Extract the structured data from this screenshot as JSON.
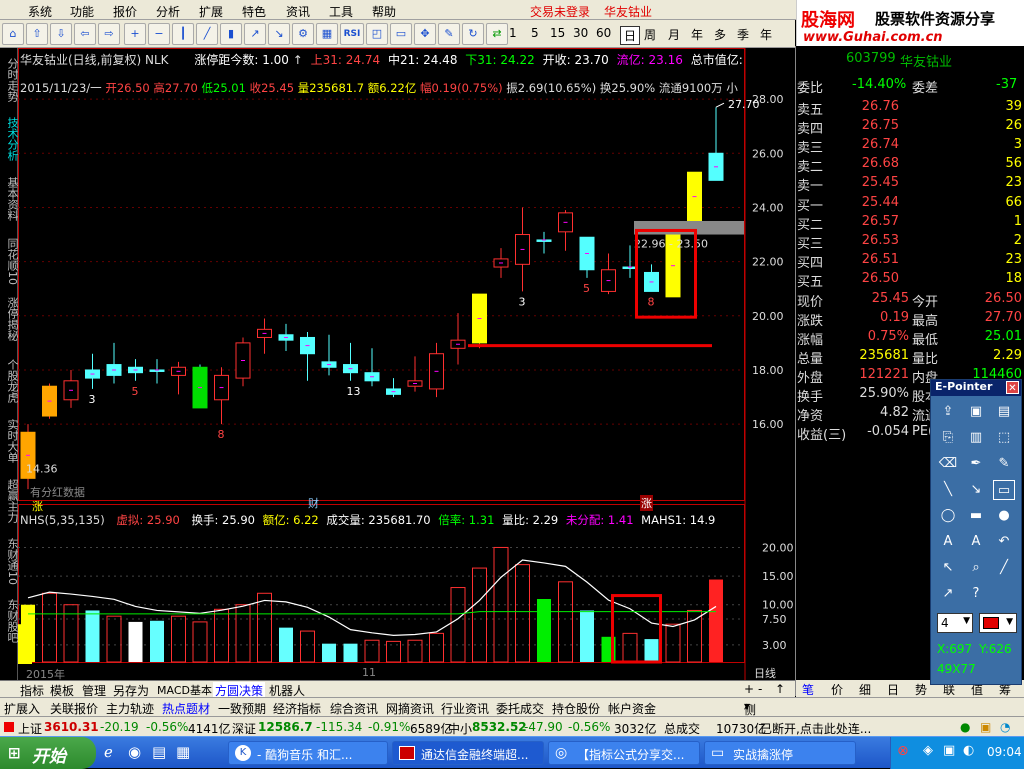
{
  "menu": {
    "items": [
      "系统",
      "功能",
      "报价",
      "分析",
      "扩展",
      "特色",
      "资讯",
      "工具",
      "帮助"
    ],
    "login_status": "交易未登录",
    "stock_title": "华友钴业"
  },
  "logo": {
    "line1_a": "股海网",
    "line1_b": "股票软件资源分享",
    "line2": "www.Guhai.com.cn"
  },
  "toolbar": {
    "periods": [
      "1",
      "5",
      "15",
      "30",
      "60",
      "日",
      "周",
      "月",
      "年",
      "多",
      "季",
      "年"
    ]
  },
  "vertical_tabs": [
    "分时走势",
    "技术分析",
    "基本资料",
    "同花顺10",
    "涨停揭秘",
    "个股龙虎",
    "实时大单",
    "超赢主力",
    "东财通10",
    "东财股吧"
  ],
  "chart_header": {
    "title": "华友钴业(日线,前复权) NLK",
    "zt_label": "涨停距今数: 1.00",
    "ma": [
      "上31: 24.74",
      "中21: 24.48",
      "下31: 24.22",
      "开收: 23.70",
      "流亿: 23.16",
      "总市值亿: 13"
    ]
  },
  "info_line": {
    "date": "2015/11/23/一",
    "open": "开26.50",
    "high": "高27.70",
    "low": "低25.01",
    "close": "收25.45",
    "vol": "量235681.7",
    "amt": "额6.22亿",
    "chg": "幅0.19(0.75%)",
    "amp": "振2.69(10.65%)",
    "turn": "换25.90%",
    "float": "流通9100万",
    "small": "小"
  },
  "chart_data": {
    "type": "candlestick",
    "price_axis": [
      28.0,
      26.0,
      24.0,
      22.0,
      20.0,
      18.0,
      16.0
    ],
    "ylim": [
      14.0,
      29.0
    ],
    "candles": [
      {
        "o": 14.0,
        "h": 16.0,
        "l": 13.6,
        "c": 15.7,
        "up": true,
        "fill": "#ffa500"
      },
      {
        "o": 16.3,
        "h": 17.5,
        "l": 16.2,
        "c": 17.4,
        "up": true,
        "fill": "#ffa500"
      },
      {
        "o": 16.9,
        "h": 18.0,
        "l": 16.6,
        "c": 17.6,
        "up": true
      },
      {
        "o": 17.7,
        "h": 18.6,
        "l": 17.3,
        "c": 18.0,
        "up": false
      },
      {
        "o": 18.2,
        "h": 19.0,
        "l": 17.5,
        "c": 17.8,
        "up": false
      },
      {
        "o": 18.1,
        "h": 18.4,
        "l": 17.6,
        "c": 17.9,
        "up": false
      },
      {
        "o": 18.0,
        "h": 18.4,
        "l": 17.5,
        "c": 18.0,
        "up": false
      },
      {
        "o": 17.8,
        "h": 18.3,
        "l": 17.1,
        "c": 18.1,
        "up": true
      },
      {
        "o": 18.1,
        "h": 18.2,
        "l": 16.6,
        "c": 16.6,
        "up": false,
        "fill": "#00e000"
      },
      {
        "o": 16.9,
        "h": 18.1,
        "l": 16.0,
        "c": 17.8,
        "up": true
      },
      {
        "o": 17.7,
        "h": 19.2,
        "l": 17.4,
        "c": 19.0,
        "up": true
      },
      {
        "o": 19.2,
        "h": 19.9,
        "l": 18.6,
        "c": 19.5,
        "up": true
      },
      {
        "o": 19.3,
        "h": 19.7,
        "l": 18.7,
        "c": 19.1,
        "up": false
      },
      {
        "o": 19.2,
        "h": 19.4,
        "l": 17.6,
        "c": 18.6,
        "up": false
      },
      {
        "o": 18.3,
        "h": 19.3,
        "l": 17.8,
        "c": 18.1,
        "up": false
      },
      {
        "o": 18.2,
        "h": 19.0,
        "l": 17.6,
        "c": 17.9,
        "up": false
      },
      {
        "o": 17.9,
        "h": 18.8,
        "l": 17.4,
        "c": 17.6,
        "up": false
      },
      {
        "o": 17.3,
        "h": 17.7,
        "l": 17.0,
        "c": 17.1,
        "up": false
      },
      {
        "o": 17.4,
        "h": 18.5,
        "l": 17.2,
        "c": 17.6,
        "up": true
      },
      {
        "o": 17.3,
        "h": 19.0,
        "l": 17.0,
        "c": 18.6,
        "up": true
      },
      {
        "o": 18.8,
        "h": 20.1,
        "l": 18.2,
        "c": 19.1,
        "up": true
      },
      {
        "o": 19.0,
        "h": 20.8,
        "l": 18.8,
        "c": 20.8,
        "up": true,
        "fill": "#ffff00"
      },
      {
        "o": 21.8,
        "h": 22.5,
        "l": 21.4,
        "c": 22.1,
        "up": true
      },
      {
        "o": 21.9,
        "h": 24.0,
        "l": 20.9,
        "c": 23.0,
        "up": true
      },
      {
        "o": 22.8,
        "h": 23.1,
        "l": 22.3,
        "c": 22.8,
        "up": false
      },
      {
        "o": 23.1,
        "h": 23.9,
        "l": 22.4,
        "c": 23.8,
        "up": true
      },
      {
        "o": 22.9,
        "h": 22.9,
        "l": 21.4,
        "c": 21.7,
        "up": false
      },
      {
        "o": 20.9,
        "h": 22.3,
        "l": 20.8,
        "c": 21.7,
        "up": true
      },
      {
        "o": 21.8,
        "h": 22.6,
        "l": 21.4,
        "c": 21.8,
        "up": false
      },
      {
        "o": 21.6,
        "h": 21.9,
        "l": 20.9,
        "c": 20.9,
        "up": false
      },
      {
        "o": 20.7,
        "h": 23.2,
        "l": 20.7,
        "c": 23.0,
        "up": true,
        "fill": "#ffff00"
      },
      {
        "o": 23.5,
        "h": 25.3,
        "l": 23.2,
        "c": 25.3,
        "up": true,
        "fill": "#ffff00"
      },
      {
        "o": 25.0,
        "h": 27.7,
        "l": 25.0,
        "c": 26.0,
        "up": false
      }
    ],
    "candle_labels": [
      {
        "i": 3,
        "t": "3",
        "c": "#fff"
      },
      {
        "i": 5,
        "t": "5",
        "c": "#f44"
      },
      {
        "i": 9,
        "t": "8",
        "c": "#f44"
      },
      {
        "i": 15,
        "t": "13",
        "c": "#fff"
      },
      {
        "i": 23,
        "t": "3",
        "c": "#fff"
      },
      {
        "i": 26,
        "t": "5",
        "c": "#f44"
      },
      {
        "i": 29,
        "t": "8",
        "c": "#f44"
      }
    ],
    "last_high_label": "27.70",
    "range_label": "22.96 - 23.50",
    "low_label": "14.36",
    "vol_axis": [
      20.0,
      15.0,
      10.0,
      7.5,
      3.0
    ],
    "volume": [
      {
        "v": 5,
        "c": "#ff0"
      },
      {
        "v": 6,
        "c": "r"
      },
      {
        "v": 5,
        "c": "r"
      },
      {
        "v": 4.5,
        "c": "#6ff"
      },
      {
        "v": 4,
        "c": "r"
      },
      {
        "v": 3.5,
        "c": "#fff"
      },
      {
        "v": 3.6,
        "c": "#6ff"
      },
      {
        "v": 4,
        "c": "r"
      },
      {
        "v": 3.5,
        "c": "r"
      },
      {
        "v": 4.6,
        "c": "r"
      },
      {
        "v": 5,
        "c": "r"
      },
      {
        "v": 6,
        "c": "r"
      },
      {
        "v": 3,
        "c": "#6ff"
      },
      {
        "v": 2.7,
        "c": "r"
      },
      {
        "v": 1.6,
        "c": "#6ff"
      },
      {
        "v": 1.6,
        "c": "#6ff"
      },
      {
        "v": 1.9,
        "c": "r"
      },
      {
        "v": 1.8,
        "c": "r"
      },
      {
        "v": 1.9,
        "c": "r"
      },
      {
        "v": 2.5,
        "c": "r"
      },
      {
        "v": 6.5,
        "c": "r"
      },
      {
        "v": 8.2,
        "c": "r"
      },
      {
        "v": 10,
        "c": "r"
      },
      {
        "v": 8.5,
        "c": "r"
      },
      {
        "v": 5.5,
        "c": "#0e0"
      },
      {
        "v": 7,
        "c": "r"
      },
      {
        "v": 4.5,
        "c": "#6ff"
      },
      {
        "v": 2.2,
        "c": "#0e0"
      },
      {
        "v": 2.5,
        "c": "r"
      },
      {
        "v": 2.0,
        "c": "#6ff"
      },
      {
        "v": 3.3,
        "c": "r"
      },
      {
        "v": 4.5,
        "c": "r"
      },
      {
        "v": 7.2,
        "c": "#f22"
      }
    ]
  },
  "indicator_line": {
    "name": "NHS(5,35,135)",
    "a": "虚拟: 25.90",
    "b": "换手: 25.90",
    "c": "额亿: 6.22",
    "d": "成交量: 235681.70",
    "e": "倍率: 1.31",
    "f": "量比: 2.29",
    "g": "未分配: 1.41",
    "h": "MAHS1: 14.9"
  },
  "markers": {
    "cai": "财",
    "zhang": "涨",
    "zhang2": "涨",
    "year": "2015年",
    "month": "11",
    "rili": "日线",
    "data_tip": "有分红数据"
  },
  "quote": {
    "code": "603799",
    "name": "华友钴业",
    "webi_label": "委比",
    "webi": "-14.40%",
    "weicha_label": "委差",
    "weicha": "-37",
    "asks": [
      {
        "l": "卖五",
        "p": "26.76",
        "v": "39"
      },
      {
        "l": "卖四",
        "p": "26.75",
        "v": "26"
      },
      {
        "l": "卖三",
        "p": "26.74",
        "v": "3"
      },
      {
        "l": "卖二",
        "p": "26.68",
        "v": "56"
      },
      {
        "l": "卖一",
        "p": "25.45",
        "v": "23"
      }
    ],
    "bids": [
      {
        "l": "买一",
        "p": "25.44",
        "v": "66"
      },
      {
        "l": "买二",
        "p": "26.57",
        "v": "1"
      },
      {
        "l": "买三",
        "p": "26.53",
        "v": "2"
      },
      {
        "l": "买四",
        "p": "26.51",
        "v": "23"
      },
      {
        "l": "买五",
        "p": "26.50",
        "v": "18"
      }
    ],
    "stats": [
      {
        "a": "现价",
        "b": "25.45",
        "c": "今开",
        "d": "26.50"
      },
      {
        "a": "涨跌",
        "b": "0.19",
        "c": "最高",
        "d": "27.70"
      },
      {
        "a": "涨幅",
        "b": "0.75%",
        "c": "最低",
        "d": "25.01"
      },
      {
        "a": "总量",
        "b": "235681",
        "c": "量比",
        "d": "2.29"
      },
      {
        "a": "外盘",
        "b": "121221",
        "c": "内盘",
        "d": "114460"
      },
      {
        "a": "换手",
        "b": "25.90%",
        "c": "股本",
        "d": ""
      },
      {
        "a": "净资",
        "b": "4.82",
        "c": "流通",
        "d": ""
      },
      {
        "a": "收益(三)",
        "b": "-0.054",
        "c": "PE(",
        "d": ""
      }
    ]
  },
  "epointer": {
    "title": "E-Pointer",
    "width": "4",
    "x": "X:697",
    "y": "Y:626",
    "size": "49X77"
  },
  "bottom_tabs": [
    "指标",
    "模板",
    "管理",
    "另存为",
    "MACD基本",
    "方圆决策",
    "机器人"
  ],
  "side_label": "侧边栏",
  "func_tabs": [
    "扩展入",
    "关联报价",
    "主力轨迹",
    "热点题材",
    "一致预期",
    "经济指标",
    "综合资讯",
    "网摘资讯",
    "行业资讯",
    "委托成交",
    "持仓股份",
    "帐户资金"
  ],
  "rp_tabs": [
    "笔",
    "价",
    "细",
    "日",
    "势",
    "联",
    "值",
    "筹"
  ],
  "status": {
    "sh_label": "上证",
    "sh": "3610.31",
    "sh_chg": "-20.19",
    "sh_pct": "-0.56%",
    "sh_amt": "4141亿",
    "sz_label": "深证",
    "sz": "12586.7",
    "sz_chg": "-115.34",
    "sz_pct": "-0.91%",
    "sz_amt": "6589亿",
    "zx_label": "中小",
    "zx": "8532.52",
    "zx_chg": "-47.90",
    "zx_pct": "-0.56%",
    "zx_amt": "3032亿",
    "total_label": "总成交",
    "total": "10730亿",
    "conn": "已断开,点击此处连..."
  },
  "taskbar": {
    "start": "开始",
    "tasks": [
      "- 酷狗音乐 和汇...",
      "通达信金融终端超...",
      "【指标公式分享交...",
      "实战擒涨停"
    ],
    "time": "09:04"
  }
}
